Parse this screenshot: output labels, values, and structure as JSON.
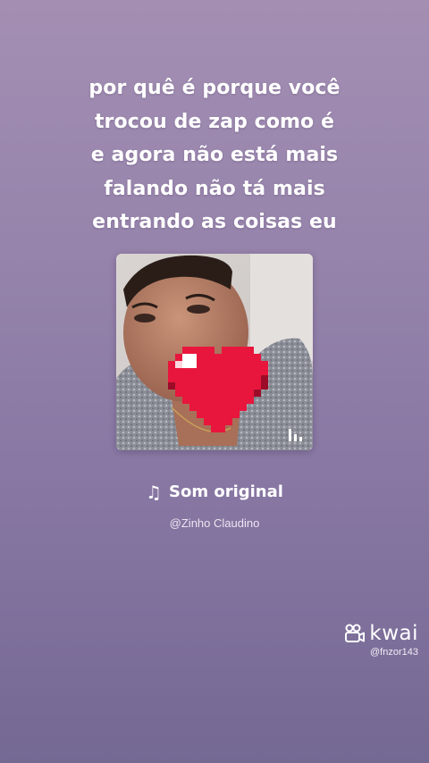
{
  "lyrics": {
    "lines": [
      "por quê é porque você",
      "trocou de zap como é",
      "e agora não está mais",
      "falando não tá mais",
      "entrando as coisas eu"
    ]
  },
  "cover": {
    "photo_icon": "person-photo-with-pixel-heart",
    "heart_color": "#e8163c",
    "playing_icon": "audio-bars-icon"
  },
  "sound": {
    "icon": "music-note-icon",
    "title": "Som original",
    "author": "@Zinho Claudino"
  },
  "watermark": {
    "logo_icon": "kwai-logo-icon",
    "brand": "kwai",
    "handle": "@fnzor143"
  },
  "theme": {
    "background_top": "#a48fb3",
    "background_bottom": "#746993",
    "text": "#ffffff"
  }
}
